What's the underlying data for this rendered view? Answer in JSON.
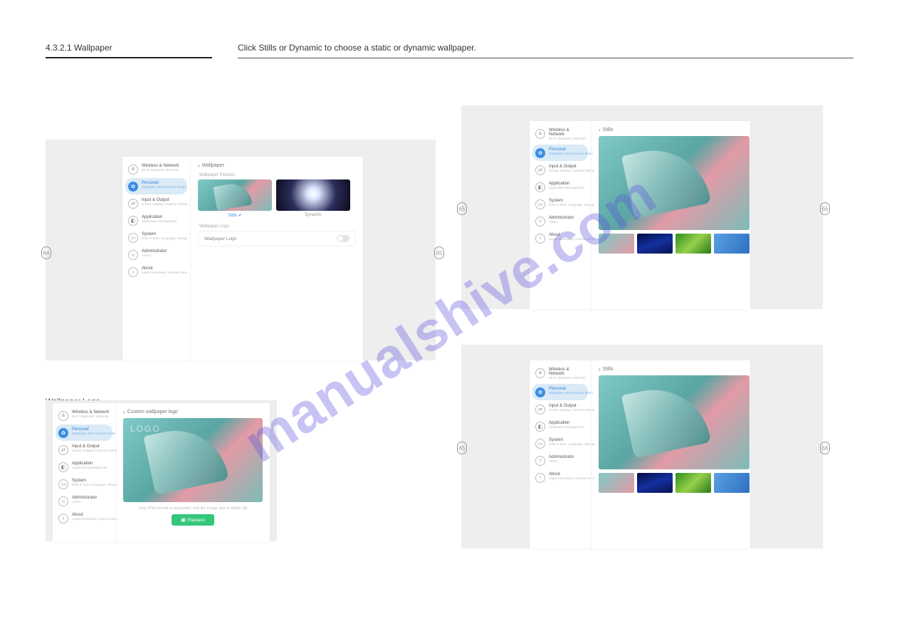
{
  "watermark": "manualshive.com",
  "section_left": "4.3.2.1 Wallpaper",
  "section_right": "Click Stills or Dynamic to choose a static or dynamic wallpaper.",
  "sub_heading": "Wallpaper Logo",
  "page_a_left": "64",
  "page_a_right": "65",
  "page_b_left": "65",
  "page_b_right": "66",
  "sidebar": {
    "items": [
      {
        "title": "Wireless & Network",
        "sub": "Wi-Fi, Bluetooth, Ethernet",
        "icon": "wifi"
      },
      {
        "title": "Personal",
        "sub": "Wallpaper, Multi-Window Mode",
        "icon": "personal"
      },
      {
        "title": "Input & Output",
        "sub": "Sound, Display, Channel Settings",
        "icon": "io"
      },
      {
        "title": "Application",
        "sub": "Application Management",
        "icon": "app"
      },
      {
        "title": "System",
        "sub": "Date & Time, Language, Storage",
        "icon": "sys"
      },
      {
        "title": "Administrator",
        "sub": "Admin",
        "icon": "admin"
      },
      {
        "title": "About",
        "sub": "Legal Information, Android Version",
        "icon": "about"
      }
    ]
  },
  "wallpaper": {
    "back": "Wallpaper",
    "pictures_label": "Wallpaper Pictures",
    "stills": "Stills",
    "dynamic": "Dynamic",
    "logo_label": "Wallpaper Logo",
    "logo_row": "Wallpaper Logo"
  },
  "stills": {
    "back": "Stills"
  },
  "custom_logo": {
    "back": "Custom wallpaper logo",
    "logo": "LOGO",
    "hint": "Only PNG format is supported, and the image size is within 1M",
    "replace": "Replace"
  }
}
